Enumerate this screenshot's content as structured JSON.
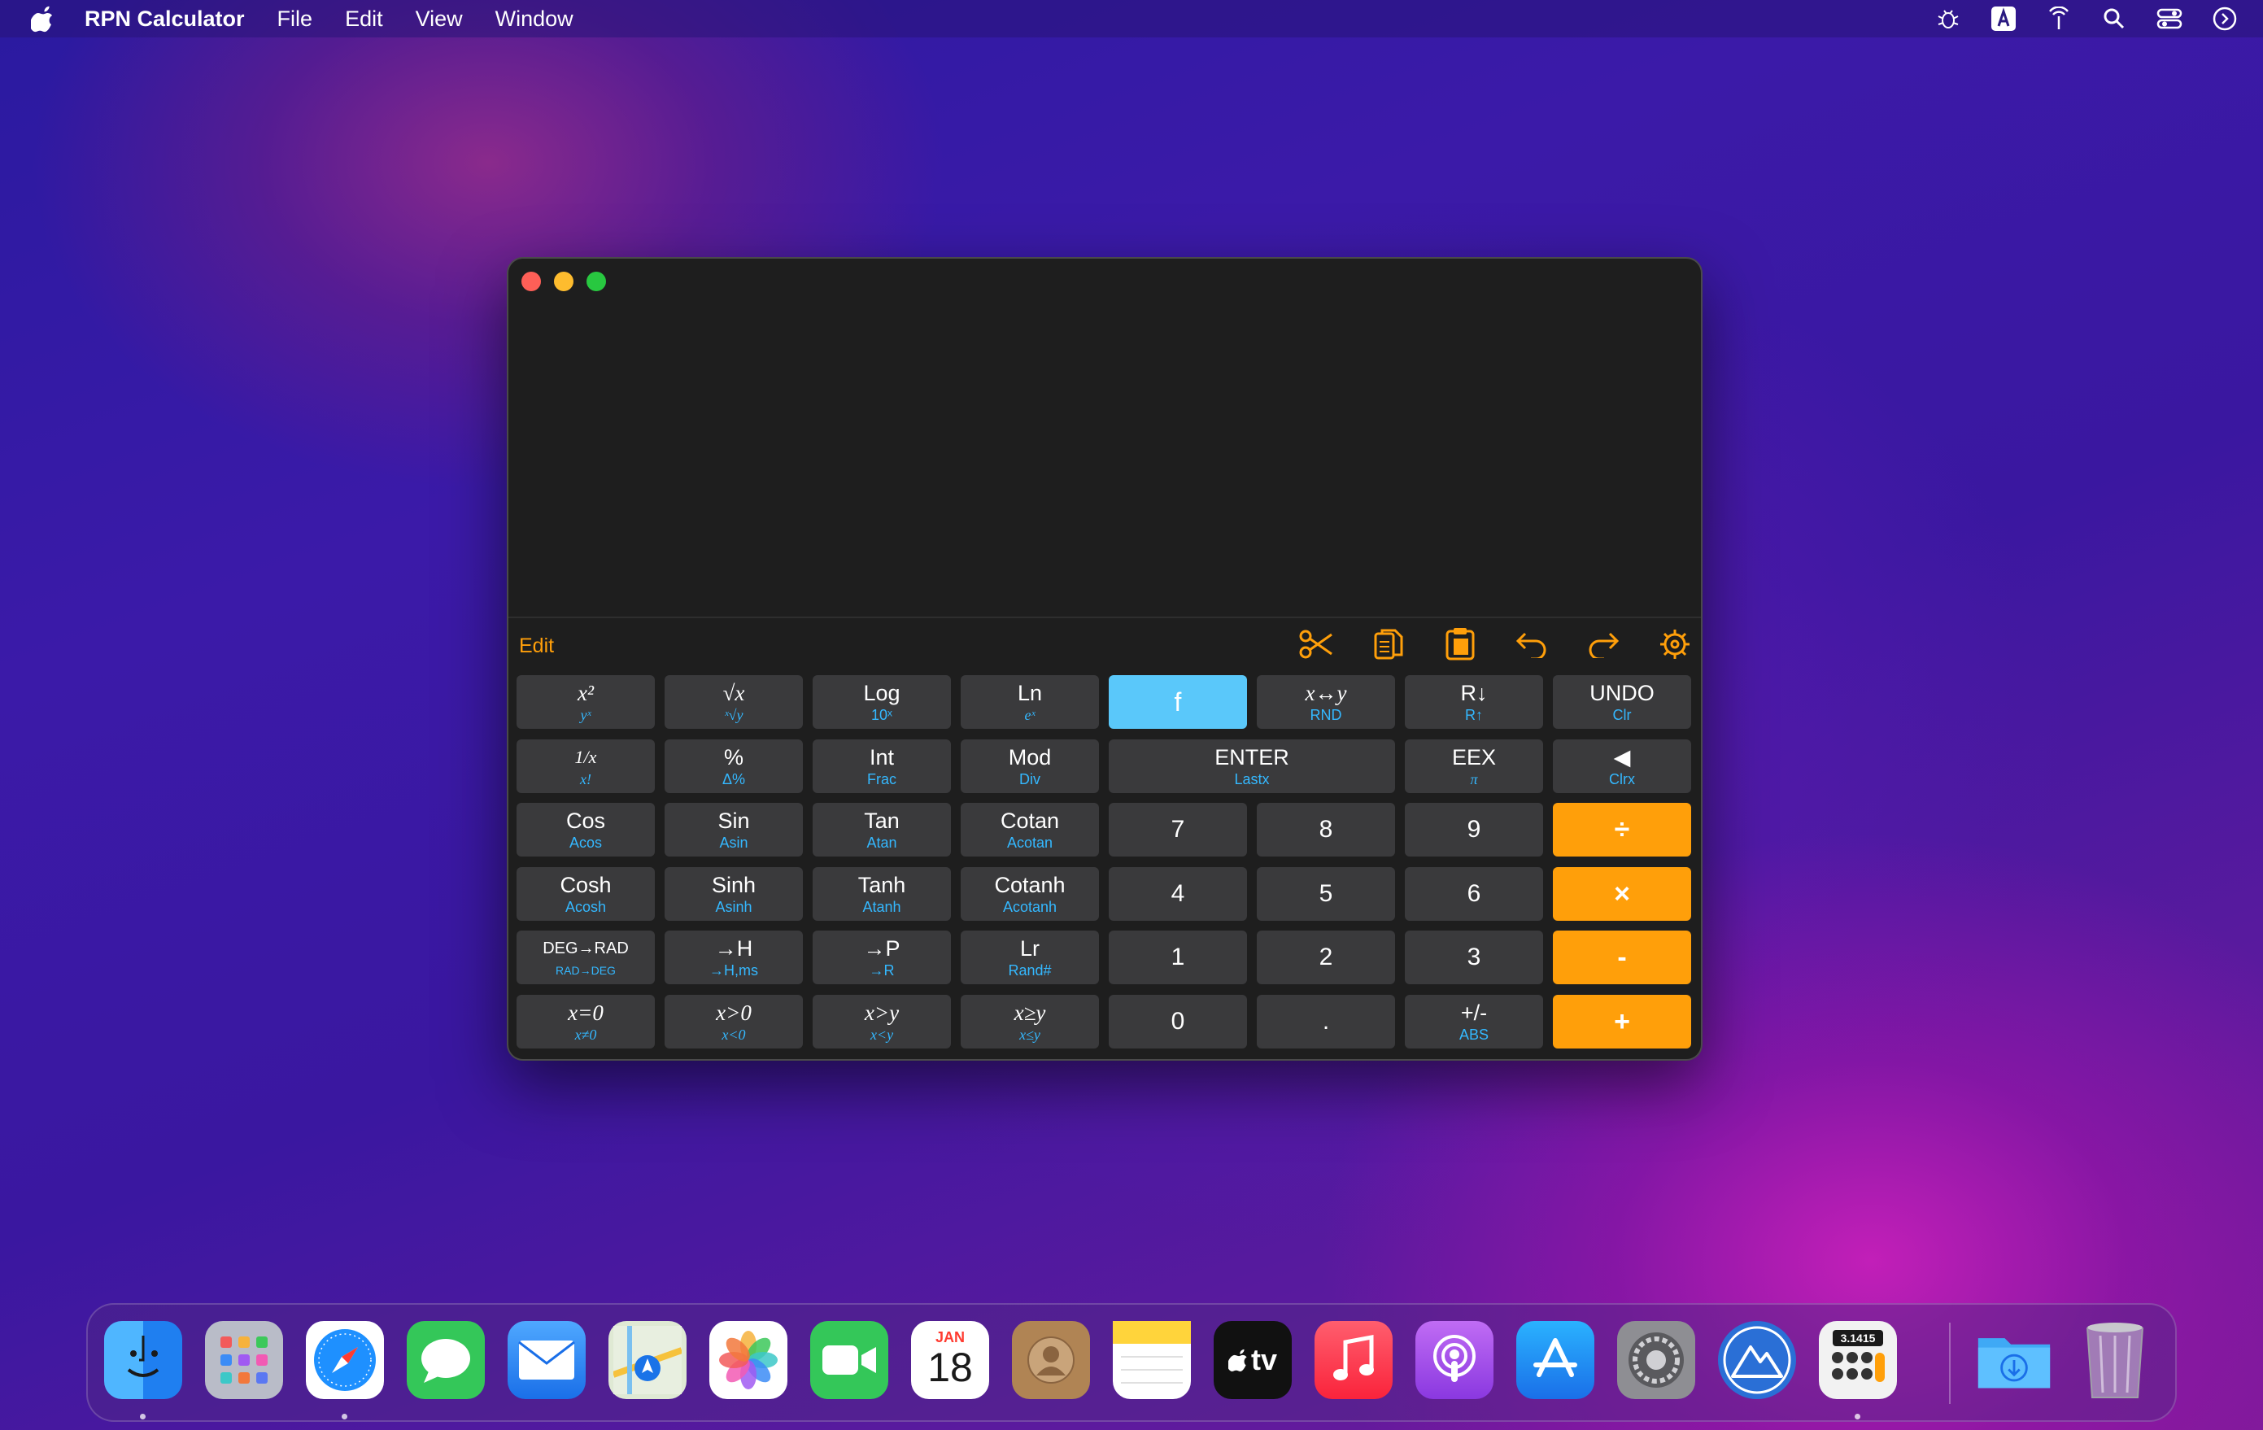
{
  "menubar": {
    "app_name": "RPN Calculator",
    "menus": [
      "File",
      "Edit",
      "View",
      "Window"
    ]
  },
  "toolbar": {
    "edit_label": "Edit"
  },
  "keys": [
    {
      "main": "x²",
      "sub": "yˣ"
    },
    {
      "main": "√x",
      "sub": "ˣ√y"
    },
    {
      "main": "Log",
      "sub": "10ˣ"
    },
    {
      "main": "Ln",
      "sub": "eˣ"
    },
    {
      "main": "f",
      "sub": ""
    },
    {
      "main": "x↔y",
      "sub": "RND"
    },
    {
      "main": "R↓",
      "sub": "R↑"
    },
    {
      "main": "UNDO",
      "sub": "Clr"
    },
    {
      "main": "1/x",
      "sub": "x!"
    },
    {
      "main": "%",
      "sub": "Δ%"
    },
    {
      "main": "Int",
      "sub": "Frac"
    },
    {
      "main": "Mod",
      "sub": "Div"
    },
    {
      "main": "ENTER",
      "sub": "Lastx"
    },
    {
      "main": "EEX",
      "sub": "π"
    },
    {
      "main": "◀",
      "sub": "Clrx"
    },
    {
      "main": "Cos",
      "sub": "Acos"
    },
    {
      "main": "Sin",
      "sub": "Asin"
    },
    {
      "main": "Tan",
      "sub": "Atan"
    },
    {
      "main": "Cotan",
      "sub": "Acotan"
    },
    {
      "main": "7",
      "sub": ""
    },
    {
      "main": "8",
      "sub": ""
    },
    {
      "main": "9",
      "sub": ""
    },
    {
      "main": "÷",
      "sub": ""
    },
    {
      "main": "Cosh",
      "sub": "Acosh"
    },
    {
      "main": "Sinh",
      "sub": "Asinh"
    },
    {
      "main": "Tanh",
      "sub": "Atanh"
    },
    {
      "main": "Cotanh",
      "sub": "Acotanh"
    },
    {
      "main": "4",
      "sub": ""
    },
    {
      "main": "5",
      "sub": ""
    },
    {
      "main": "6",
      "sub": ""
    },
    {
      "main": "×",
      "sub": ""
    },
    {
      "main": "DEG→RAD",
      "sub": "RAD→DEG"
    },
    {
      "main": "→H",
      "sub": "→H,ms"
    },
    {
      "main": "→P",
      "sub": "→R"
    },
    {
      "main": "Lr",
      "sub": "Rand#"
    },
    {
      "main": "1",
      "sub": ""
    },
    {
      "main": "2",
      "sub": ""
    },
    {
      "main": "3",
      "sub": ""
    },
    {
      "main": "-",
      "sub": ""
    },
    {
      "main": "x=0",
      "sub": "x≠0"
    },
    {
      "main": "x>0",
      "sub": "x<0"
    },
    {
      "main": "x>y",
      "sub": "x<y"
    },
    {
      "main": "x≥y",
      "sub": "x≤y"
    },
    {
      "main": "0",
      "sub": ""
    },
    {
      "main": ".",
      "sub": ""
    },
    {
      "main": "+/-",
      "sub": "ABS"
    },
    {
      "main": "+",
      "sub": ""
    }
  ],
  "dock": {
    "calendar_month": "JAN",
    "calendar_day": "18",
    "tv_label": "tv",
    "calc_label": "3.1415"
  },
  "colors": {
    "accent_orange": "#ff9f0a",
    "accent_blue": "#5ac8fa",
    "sub_label_blue": "#34b8ff",
    "key_gray": "#3a3a3c"
  }
}
